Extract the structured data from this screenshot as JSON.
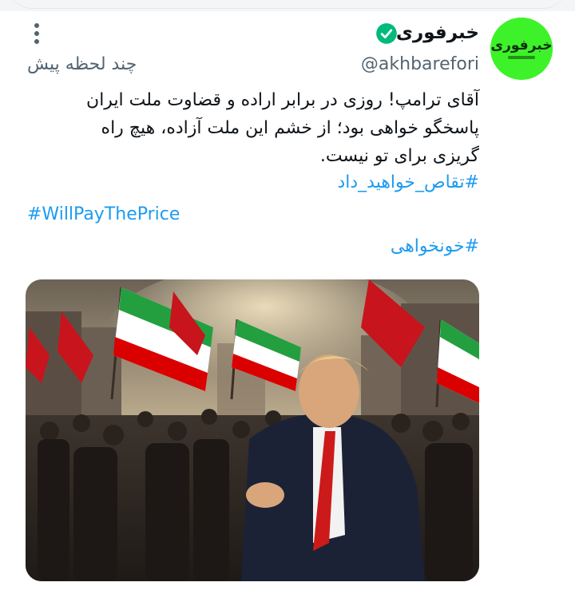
{
  "account": {
    "display_name": "خبرفوری",
    "handle": "@akhbarefori",
    "avatar_text": "خبرفوری",
    "avatar_color": "#3ef22a"
  },
  "post": {
    "time": "چند لحظه پیش",
    "text": "آقای ترامپ! روزی در برابر اراده و قضاوت ملت ایران پاسخگو خواهی بود؛ از خشم این ملت آزاده، هیچ راه گریزی برای تو نیست.",
    "hashtags": [
      "#تقاص_خواهید_داد",
      "#WillPayThePrice",
      "#خونخواهی"
    ]
  },
  "icons": {
    "verified": "verified-check-icon",
    "more": "more-options-icon"
  },
  "colors": {
    "link": "#1d9bf0",
    "verified": "#00ba7c",
    "muted": "#536471"
  }
}
